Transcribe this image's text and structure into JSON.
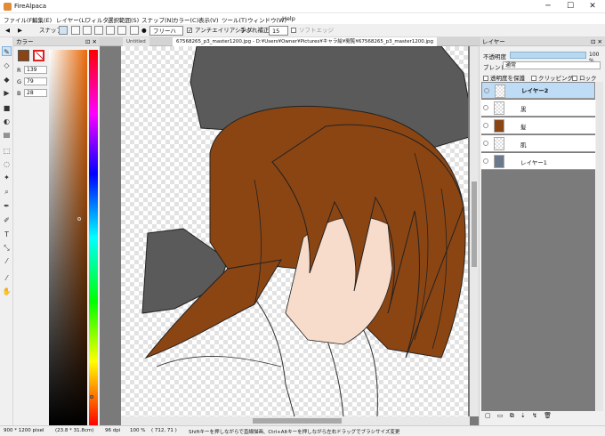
{
  "window": {
    "title": "FireAlpaca",
    "minimize": "─",
    "maximize": "☐",
    "close": "✕"
  },
  "menu": [
    "ファイル(F)",
    "編集(E)",
    "レイヤー(L)",
    "フィルタ",
    "選択範囲(S)",
    "スナップ(N)",
    "カラー(C)",
    "表示(V)",
    "ツール(T)",
    "ウィンドウ(W)",
    "Help"
  ],
  "toolbar": {
    "snap_label": "スナップ",
    "brush_mode": "フリーハンド",
    "antialias_label": "アンチエイリアシング",
    "antialias_checked": true,
    "stabilizer_label": "手ぶれ補正",
    "stabilizer_value": "15",
    "soft_edge_label": "ソフトエッジ",
    "soft_edge_checked": false
  },
  "tools": [
    "pen-icon",
    "eraser-icon",
    "brush-icon",
    "bucket-icon",
    "fill-icon",
    "rotate-icon",
    "gradient-icon",
    "select-rect-icon",
    "lasso-icon",
    "magic-wand-icon",
    "zoom-icon",
    "pen-tool-icon",
    "select-pen-icon",
    "text-icon",
    "move-icon",
    "dropper-icon",
    "hand-icon",
    "eyedropper-icon",
    "grab-icon"
  ],
  "color_panel": {
    "title": "カラー",
    "pin": "⊡ ✕",
    "fg_color": "#8b4513",
    "r_label": "R",
    "r_value": "139",
    "g_label": "G",
    "g_value": "79",
    "b_label": "B",
    "b_value": "28"
  },
  "canvas": {
    "tab_inactive": "Untitled",
    "tab_active": "67568265_p3_master1200.jpg - D:¥Users¥Owner¥Pictures¥キャラ絵¥閲覧¥67568265_p3_master1200.jpg",
    "hair_color": "#8b4513",
    "hat_color": "#5a5a5a",
    "skin_color": "#f7dccb"
  },
  "layer_panel": {
    "title": "レイヤー",
    "pin": "⊡ ✕",
    "opacity_label": "不透明度",
    "opacity_value": "100 %",
    "blend_label": "ブレンド",
    "blend_value": "通常",
    "protect_alpha": "透明度を保護",
    "clipping": "クリッピング",
    "lock": "ロック",
    "layers": [
      {
        "name": "レイヤー2",
        "selected": true
      },
      {
        "name": "黒",
        "selected": false
      },
      {
        "name": "髪",
        "selected": false
      },
      {
        "name": "肌",
        "selected": false
      },
      {
        "name": "レイヤー1",
        "selected": false
      }
    ]
  },
  "status": {
    "size": "900 * 1200 pixel",
    "physical": "(23.8 * 31.8cm)",
    "dpi": "96 dpi",
    "zoom": "100 %",
    "coords": "( 712, 71 )",
    "hint": "Shiftキーを押しながらで直線描画、Ctrl+Altキーを押しながら左右ドラッグでブラシサイズ変更"
  }
}
